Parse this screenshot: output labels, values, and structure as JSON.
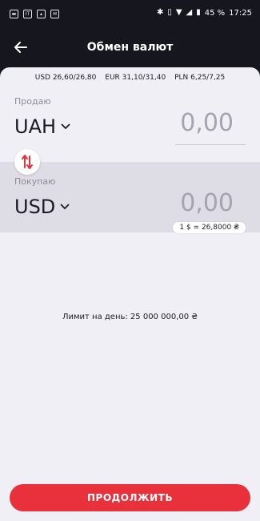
{
  "status_bar": {
    "battery": "45 %",
    "time": "17:25",
    "left_icons": [
      "box-icon",
      "news-icon",
      "image-icon",
      "mail-icon"
    ],
    "right_icons": [
      "bluetooth-icon",
      "vibrate-icon",
      "wifi-icon",
      "signal-icon",
      "battery-icon"
    ]
  },
  "header": {
    "title": "Обмен валют",
    "back_icon": "back-arrow-icon"
  },
  "rates": [
    "USD 26,60/26,80",
    "EUR 31,10/31,40",
    "PLN 6,25/7,25"
  ],
  "sell": {
    "label": "Продаю",
    "currency": "UAH",
    "amount": "0,00"
  },
  "buy": {
    "label": "Покупаю",
    "currency": "USD",
    "amount": "0,00"
  },
  "rate_chip": "1 $ = 26,8000 ₴",
  "limit_text": "Лимит на день: 25 000 000,00 ₴",
  "continue_label": "ПРОДОЛЖИТЬ",
  "colors": {
    "accent": "#e8313a",
    "dark_bg": "#16161e",
    "sheet_bg": "#f0eff5"
  }
}
